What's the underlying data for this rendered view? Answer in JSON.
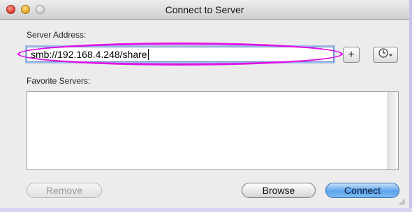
{
  "window": {
    "title": "Connect to Server"
  },
  "server_address": {
    "label": "Server Address:",
    "value": "smb://192.168.4.248/share"
  },
  "buttons": {
    "add_label": "+",
    "recent_icon": "clock-icon",
    "remove_label": "Remove",
    "browse_label": "Browse",
    "connect_label": "Connect"
  },
  "favorites": {
    "label": "Favorite Servers:",
    "items": []
  },
  "colors": {
    "highlight": "#e010e6",
    "connect": "#5aa3ea"
  }
}
